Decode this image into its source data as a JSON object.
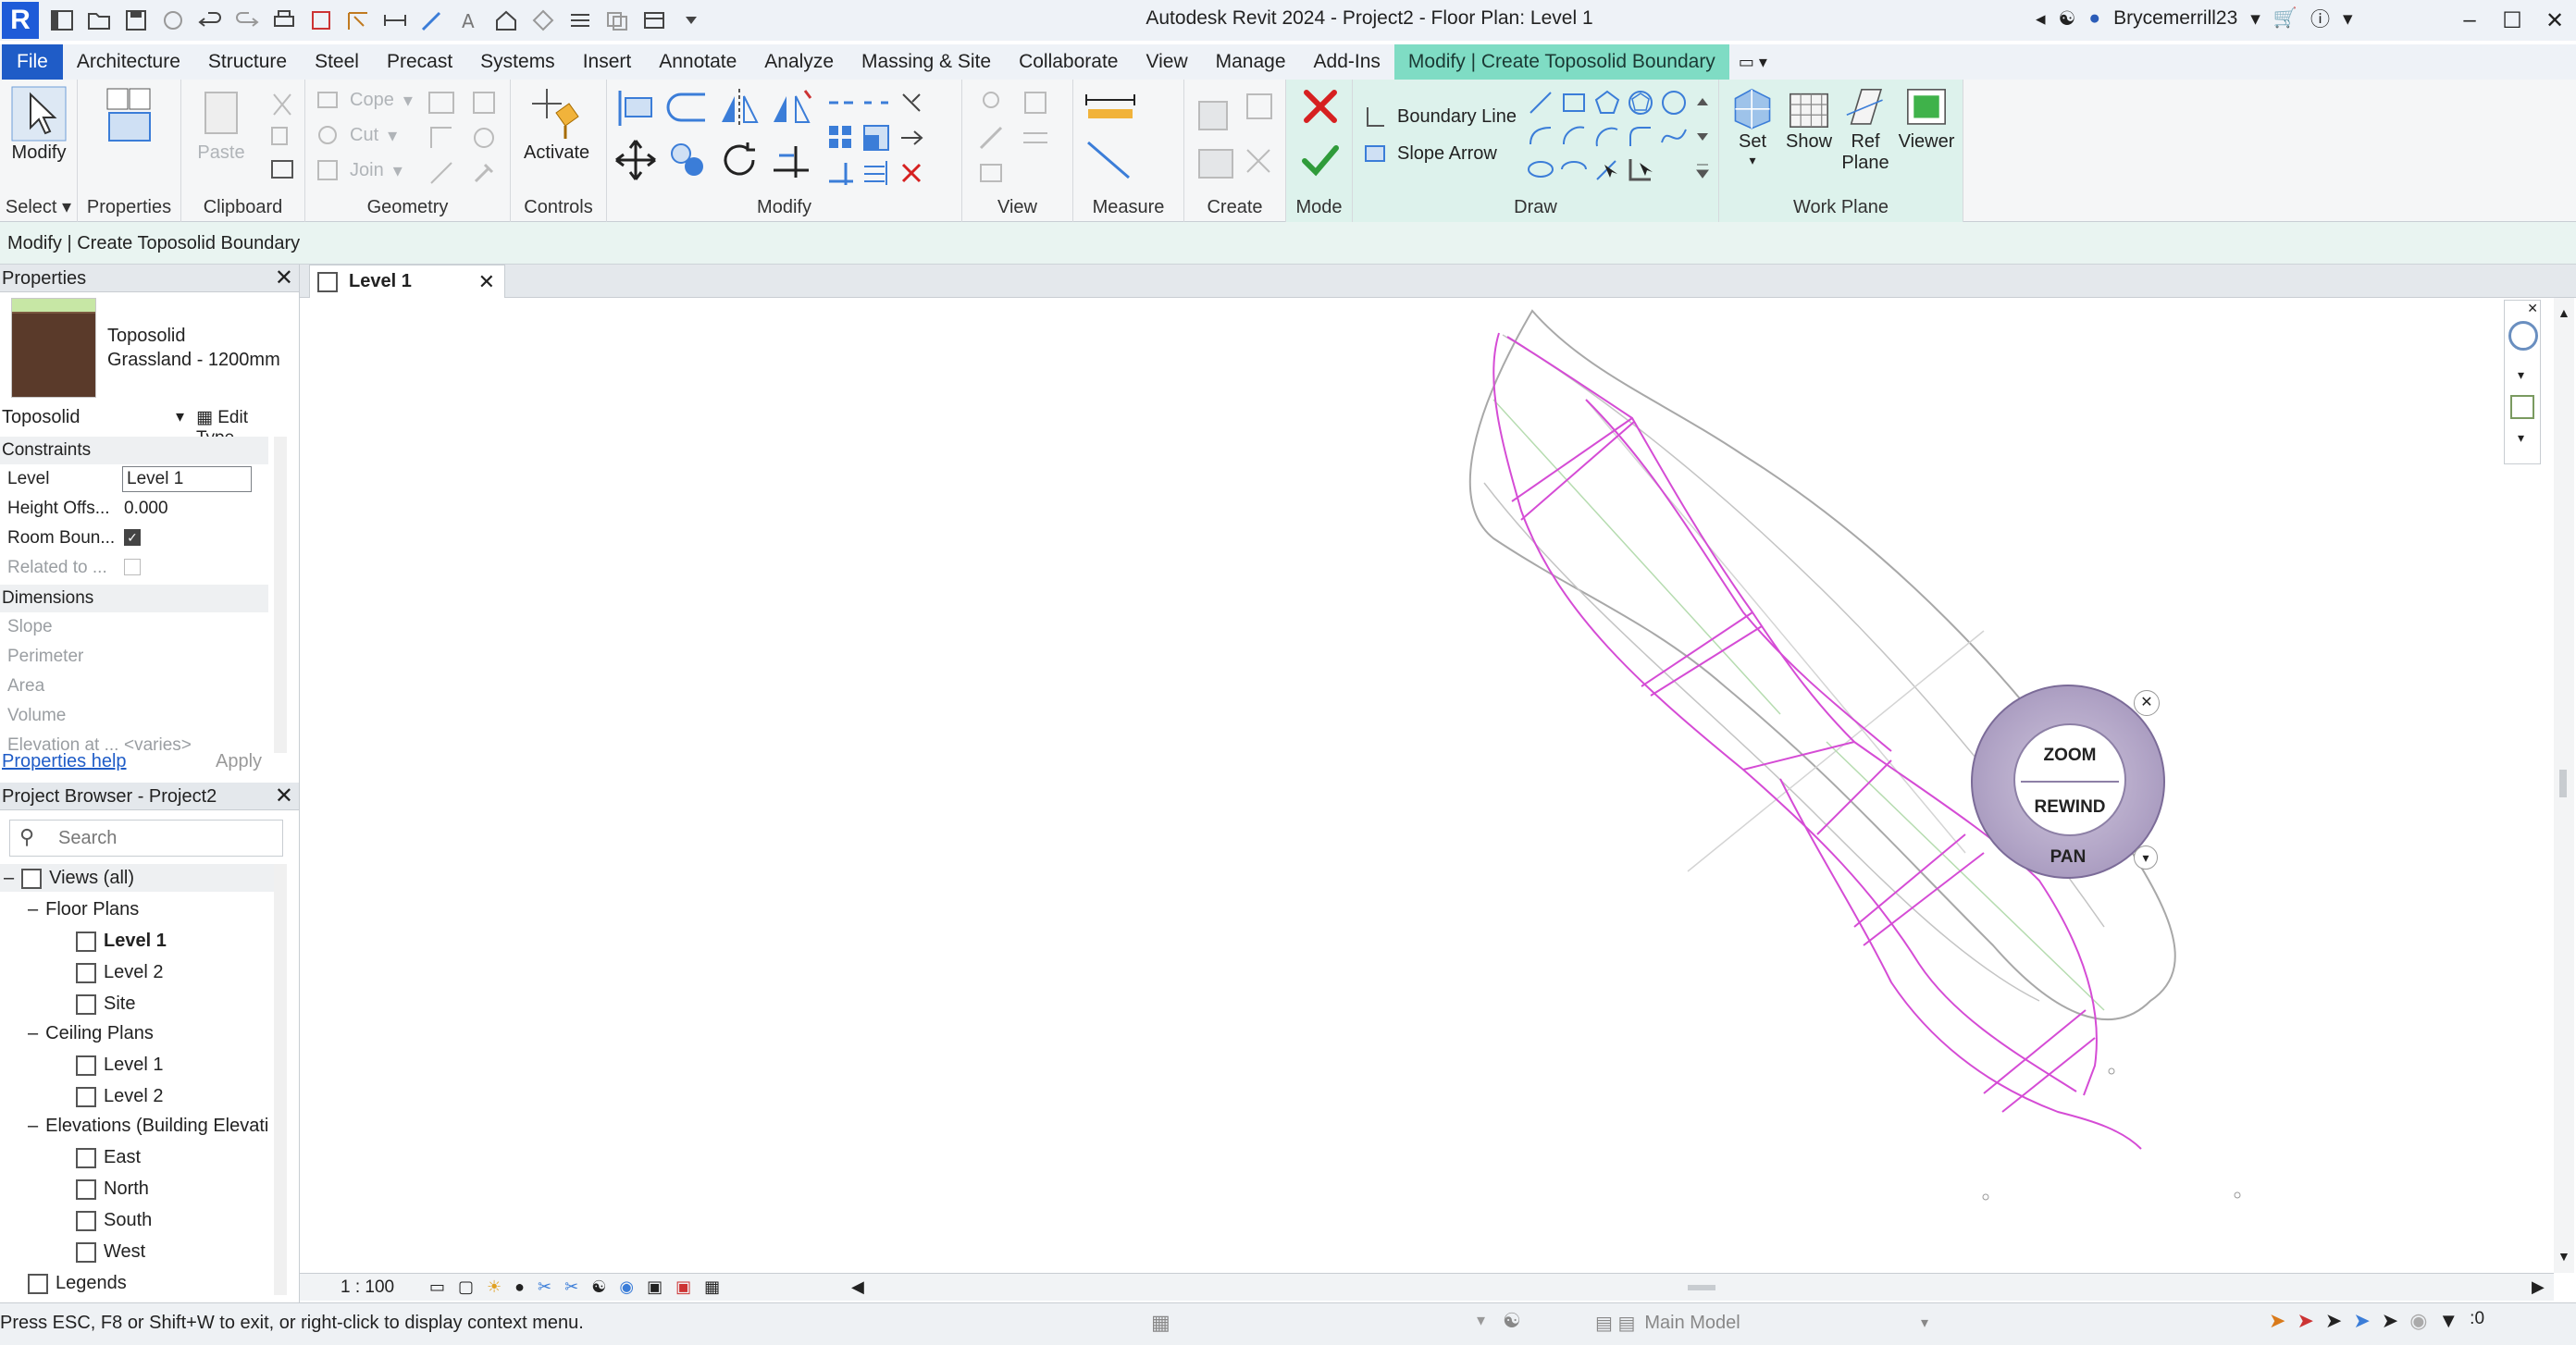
{
  "window": {
    "title": "Autodesk Revit 2024 - Project2 - Floor Plan: Level 1",
    "user": "Brycemerrill23",
    "logo": "R"
  },
  "ribbon_tabs": [
    "File",
    "Architecture",
    "Structure",
    "Steel",
    "Precast",
    "Systems",
    "Insert",
    "Annotate",
    "Analyze",
    "Massing & Site",
    "Collaborate",
    "View",
    "Manage",
    "Add-Ins",
    "Modify | Create Toposolid Boundary"
  ],
  "ribbon": {
    "select": {
      "modify": "Modify",
      "select": "Select"
    },
    "properties": {
      "label": "Properties"
    },
    "clipboard": {
      "paste": "Paste",
      "label": "Clipboard",
      "cope": "Cope",
      "cut": "Cut",
      "join": "Join"
    },
    "geometry": {
      "label": "Geometry"
    },
    "controls": {
      "activate": "Activate",
      "label": "Controls"
    },
    "modify": {
      "label": "Modify"
    },
    "view": {
      "label": "View"
    },
    "measure": {
      "label": "Measure"
    },
    "create": {
      "label": "Create"
    },
    "mode": {
      "label": "Mode"
    },
    "draw": {
      "boundary_line": "Boundary Line",
      "slope_arrow": "Slope Arrow",
      "label": "Draw"
    },
    "work_plane": {
      "set": "Set",
      "show": "Show",
      "ref": "Ref",
      "plane": "Plane",
      "viewer": "Viewer",
      "label": "Work Plane"
    }
  },
  "options_bar": "Modify | Create Toposolid Boundary",
  "properties": {
    "header": "Properties",
    "type_line1": "Toposolid",
    "type_line2": "Grassland - 1200mm",
    "selector": "Toposolid",
    "edit_type": "Edit Type",
    "sections": {
      "constraints": "Constraints",
      "dimensions": "Dimensions"
    },
    "rows": {
      "level_k": "Level",
      "level_v": "Level 1",
      "height_k": "Height Offs...",
      "height_v": "0.000",
      "room_k": "Room Boun...",
      "related_k": "Related to ...",
      "slope_k": "Slope",
      "perimeter_k": "Perimeter",
      "area_k": "Area",
      "volume_k": "Volume",
      "elevation_k": "Elevation at ...",
      "elevation_v": "<varies>"
    },
    "help": "Properties help",
    "apply": "Apply"
  },
  "browser": {
    "header": "Project Browser - Project2",
    "search_placeholder": "Search",
    "views_all": "Views (all)",
    "floor_plans": "Floor Plans",
    "fp_level1": "Level 1",
    "fp_level2": "Level 2",
    "fp_site": "Site",
    "ceiling_plans": "Ceiling Plans",
    "cp_level1": "Level 1",
    "cp_level2": "Level 2",
    "elevations": "Elevations (Building Elevati",
    "east": "East",
    "north": "North",
    "south": "South",
    "west": "West",
    "legends": "Legends"
  },
  "view_tab": "Level 1",
  "wheel": {
    "zoom": "ZOOM",
    "rewind": "REWIND",
    "pan": "PAN"
  },
  "view_scale": "1 : 100",
  "status": {
    "message": "Press ESC, F8 or Shift+W to exit, or right-click to display context menu.",
    "model": "Main Model",
    "filter_count": ":0"
  },
  "colors": {
    "file_tab": "#1f5cc7",
    "context_tab": "#7fdcc4",
    "sketch_line": "#d54cd5",
    "toposolid_edge": "#a8a8a8",
    "cancel": "#d62020",
    "finish": "#2f9b3a"
  }
}
